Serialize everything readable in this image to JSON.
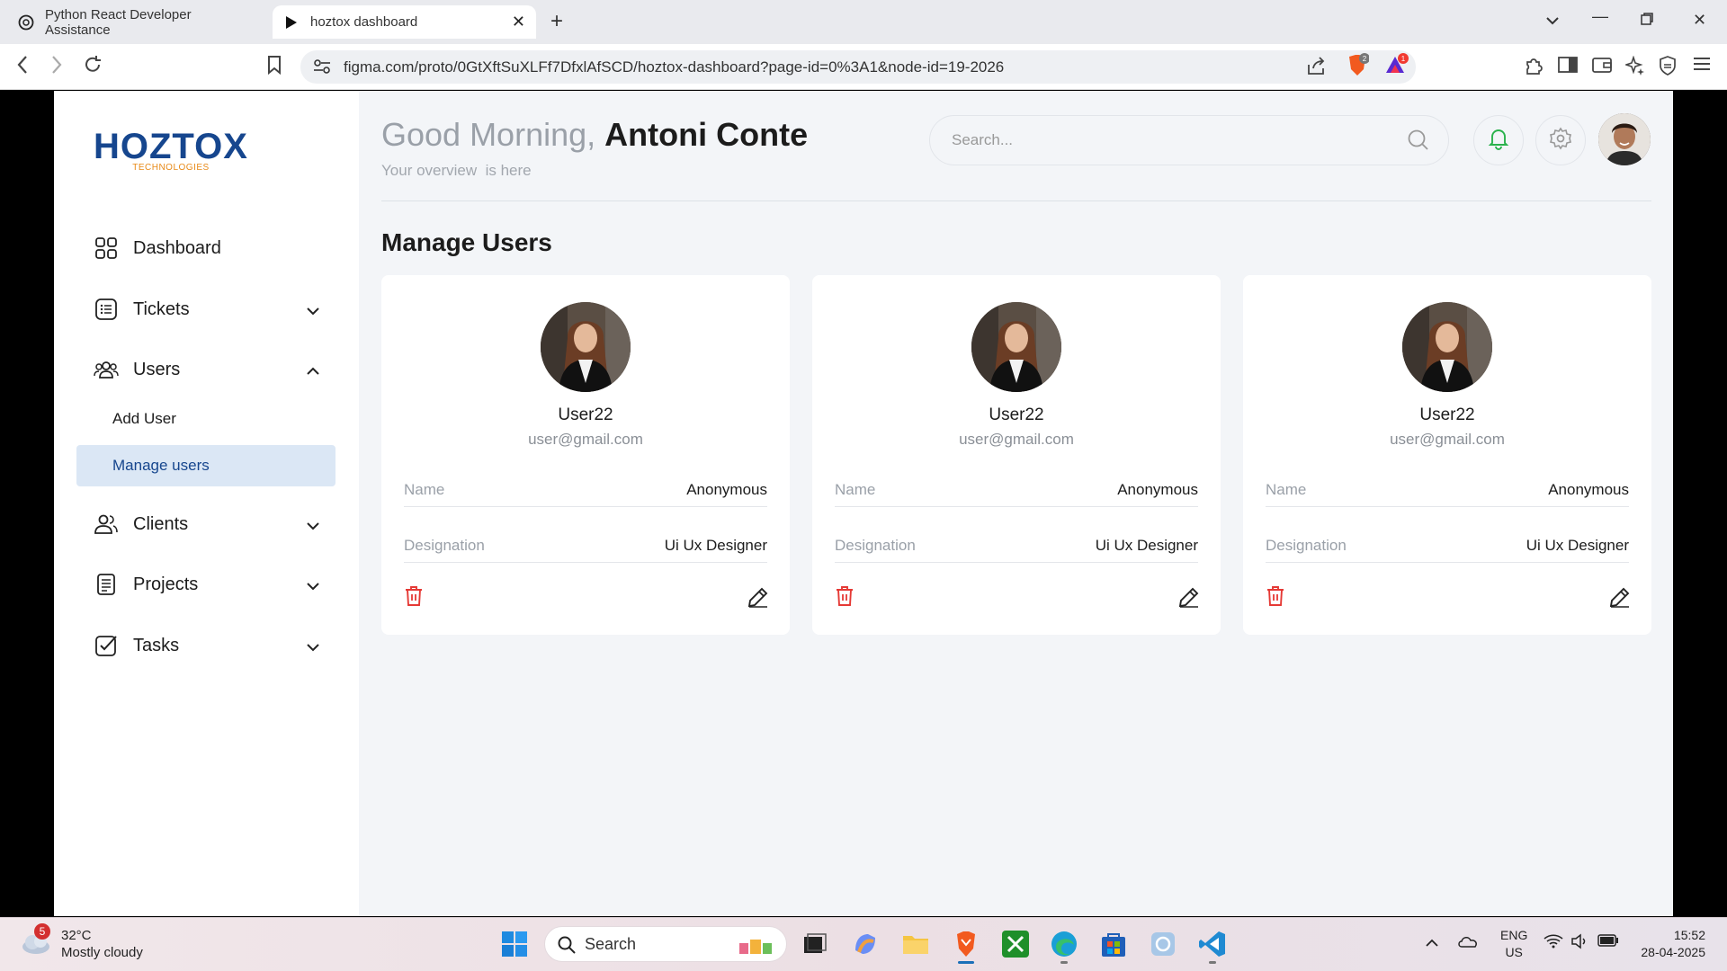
{
  "browser": {
    "tabs": [
      {
        "title": "Python React Developer Assistance",
        "active": false
      },
      {
        "title": "hoztox dashboard",
        "active": true
      }
    ],
    "url": "figma.com/proto/0GtXftSuXLFf7DfxlAfSCD/hoztox-dashboard?page-id=0%3A1&node-id=19-2026",
    "brave_badge": "2",
    "alert_badge": "1"
  },
  "app": {
    "logo_text": "HOZTOX",
    "logo_sub": "TECHNOLOGIES",
    "greeting_prefix": "Good Morning,",
    "user_name": "Antoni Conte",
    "subtitle": "Your overview  is here",
    "search_placeholder": "Search...",
    "section_title": "Manage Users",
    "accent": "#16468e",
    "danger": "#e53935"
  },
  "sidebar": {
    "items": [
      {
        "label": "Dashboard",
        "icon": "grid-icon"
      },
      {
        "label": "Tickets",
        "icon": "list-icon"
      },
      {
        "label": "Users",
        "icon": "users-icon"
      },
      {
        "label": "Clients",
        "icon": "clients-icon"
      },
      {
        "label": "Projects",
        "icon": "document-icon"
      },
      {
        "label": "Tasks",
        "icon": "checkbox-icon"
      }
    ],
    "users_sub": [
      {
        "label": "Add User"
      },
      {
        "label": "Manage users",
        "active": true
      }
    ]
  },
  "users": [
    {
      "username": "User22",
      "email": "user@gmail.com",
      "name_label": "Name",
      "name": "Anonymous",
      "designation_label": "Designation",
      "designation": "Ui Ux Designer"
    },
    {
      "username": "User22",
      "email": "user@gmail.com",
      "name_label": "Name",
      "name": "Anonymous",
      "designation_label": "Designation",
      "designation": "Ui Ux Designer"
    },
    {
      "username": "User22",
      "email": "user@gmail.com",
      "name_label": "Name",
      "name": "Anonymous",
      "designation_label": "Designation",
      "designation": "Ui Ux Designer"
    }
  ],
  "taskbar": {
    "weather_badge": "5",
    "temperature": "32°C",
    "weather": "Mostly cloudy",
    "search_label": "Search",
    "lang": "ENG",
    "region": "US",
    "time": "15:52",
    "date": "28-04-2025"
  }
}
